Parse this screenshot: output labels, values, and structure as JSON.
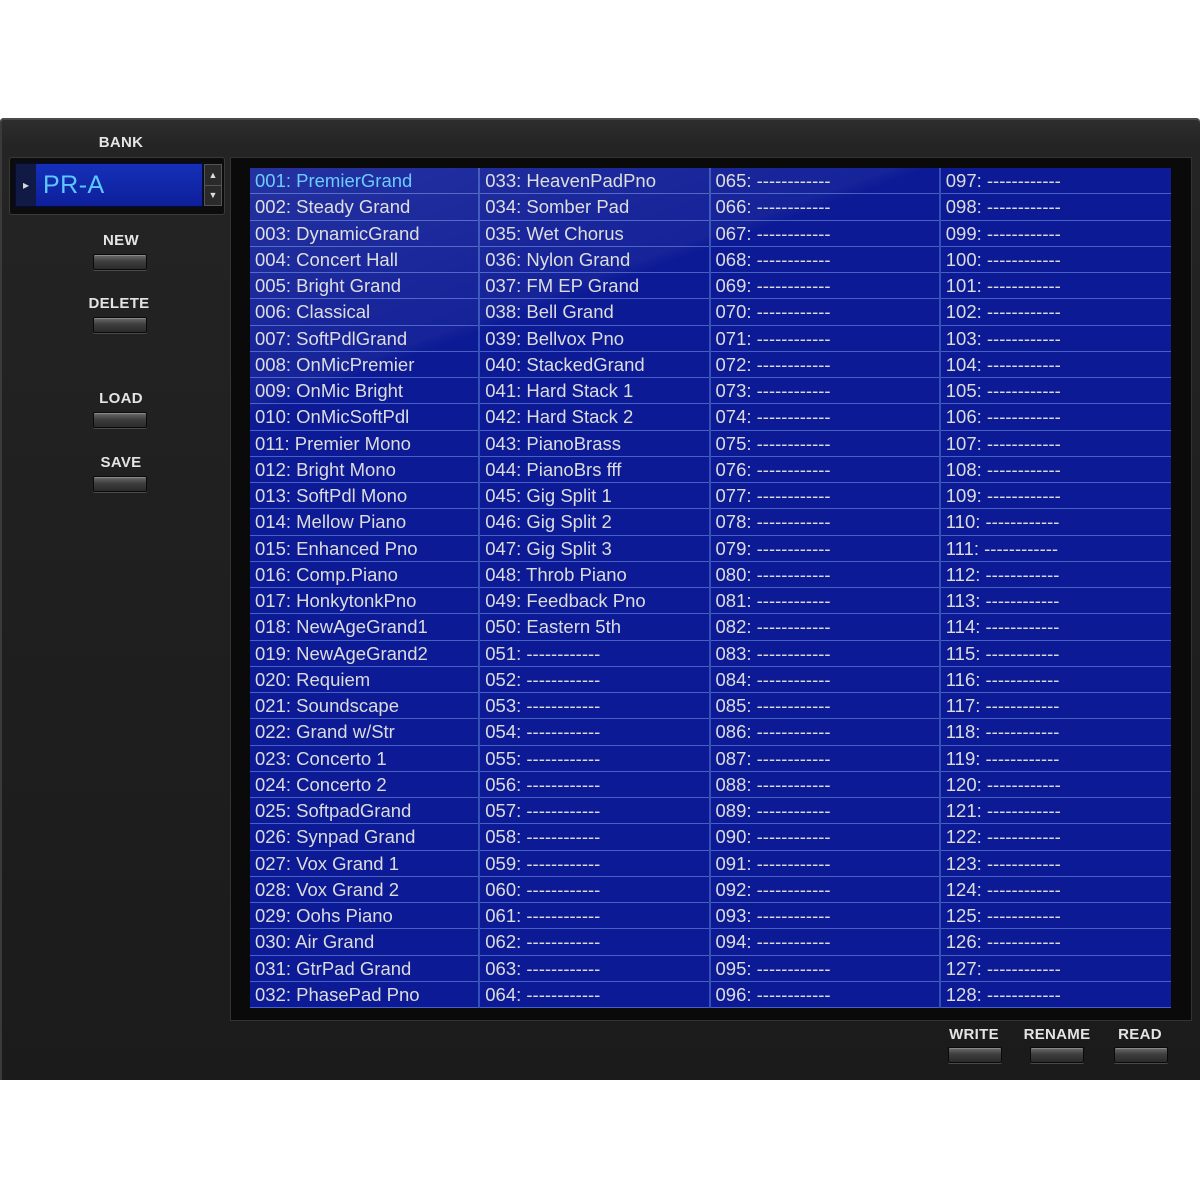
{
  "sidebar": {
    "bank_label": "BANK",
    "bank_value": "PR-A",
    "new_label": "NEW",
    "delete_label": "DELETE",
    "load_label": "LOAD",
    "save_label": "SAVE"
  },
  "footer": {
    "write_label": "WRITE",
    "rename_label": "RENAME",
    "read_label": "READ"
  },
  "list": {
    "selected_index": 0,
    "columns": [
      [
        "001: PremierGrand",
        "002: Steady Grand",
        "003: DynamicGrand",
        "004: Concert Hall",
        "005: Bright Grand",
        "006: Classical",
        "007: SoftPdlGrand",
        "008: OnMicPremier",
        "009: OnMic Bright",
        "010: OnMicSoftPdl",
        "011: Premier Mono",
        "012: Bright Mono",
        "013: SoftPdl Mono",
        "014: Mellow Piano",
        "015: Enhanced Pno",
        "016: Comp.Piano",
        "017: HonkytonkPno",
        "018: NewAgeGrand1",
        "019: NewAgeGrand2",
        "020: Requiem",
        "021: Soundscape",
        "022: Grand w/Str",
        "023: Concerto 1",
        "024: Concerto 2",
        "025: SoftpadGrand",
        "026: Synpad Grand",
        "027: Vox Grand 1",
        "028: Vox Grand 2",
        "029: Oohs Piano",
        "030: Air Grand",
        "031: GtrPad Grand",
        "032: PhasePad Pno"
      ],
      [
        "033: HeavenPadPno",
        "034: Somber Pad",
        "035: Wet Chorus",
        "036: Nylon Grand",
        "037: FM EP Grand",
        "038: Bell Grand",
        "039: Bellvox Pno",
        "040: StackedGrand",
        "041: Hard Stack 1",
        "042: Hard Stack 2",
        "043: PianoBrass",
        "044: PianoBrs fff",
        "045: Gig Split 1",
        "046: Gig Split 2",
        "047: Gig Split 3",
        "048: Throb Piano",
        "049: Feedback Pno",
        "050: Eastern 5th",
        "051: ------------",
        "052: ------------",
        "053: ------------",
        "054: ------------",
        "055: ------------",
        "056: ------------",
        "057: ------------",
        "058: ------------",
        "059: ------------",
        "060: ------------",
        "061: ------------",
        "062: ------------",
        "063: ------------",
        "064: ------------"
      ],
      [
        "065: ------------",
        "066: ------------",
        "067: ------------",
        "068: ------------",
        "069: ------------",
        "070: ------------",
        "071: ------------",
        "072: ------------",
        "073: ------------",
        "074: ------------",
        "075: ------------",
        "076: ------------",
        "077: ------------",
        "078: ------------",
        "079: ------------",
        "080: ------------",
        "081: ------------",
        "082: ------------",
        "083: ------------",
        "084: ------------",
        "085: ------------",
        "086: ------------",
        "087: ------------",
        "088: ------------",
        "089: ------------",
        "090: ------------",
        "091: ------------",
        "092: ------------",
        "093: ------------",
        "094: ------------",
        "095: ------------",
        "096: ------------"
      ],
      [
        "097: ------------",
        "098: ------------",
        "099: ------------",
        "100: ------------",
        "101: ------------",
        "102: ------------",
        "103: ------------",
        "104: ------------",
        "105: ------------",
        "106: ------------",
        "107: ------------",
        "108: ------------",
        "109: ------------",
        "110: ------------",
        "111: ------------",
        "112: ------------",
        "113: ------------",
        "114: ------------",
        "115: ------------",
        "116: ------------",
        "117: ------------",
        "118: ------------",
        "119: ------------",
        "120: ------------",
        "121: ------------",
        "122: ------------",
        "123: ------------",
        "124: ------------",
        "125: ------------",
        "126: ------------",
        "127: ------------",
        "128: ------------"
      ]
    ]
  }
}
